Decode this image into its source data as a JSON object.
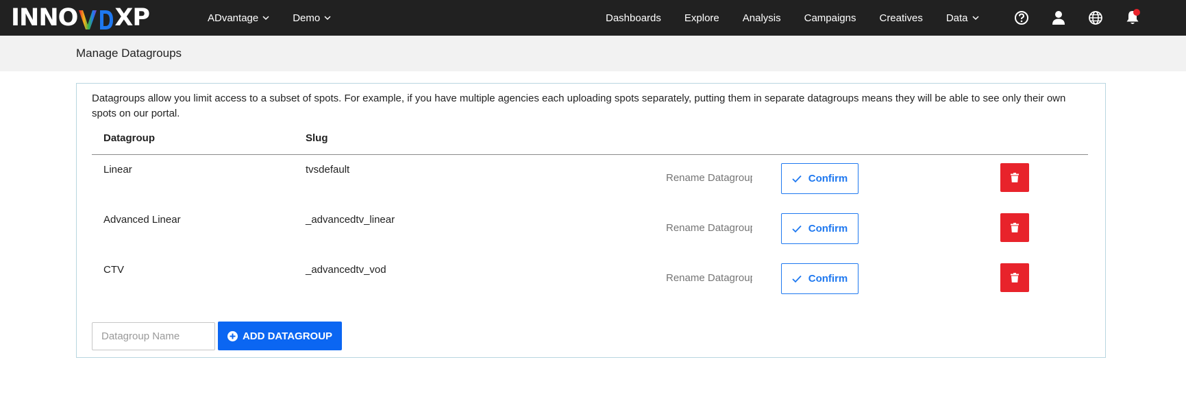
{
  "brand": {
    "logo_prefix": "INNO",
    "logo_suffix": "XP"
  },
  "nav": {
    "left": [
      {
        "label": "ADvantage"
      },
      {
        "label": "Demo"
      }
    ],
    "right": [
      {
        "label": "Dashboards"
      },
      {
        "label": "Explore"
      },
      {
        "label": "Analysis"
      },
      {
        "label": "Campaigns"
      },
      {
        "label": "Creatives"
      },
      {
        "label": "Data"
      }
    ],
    "icons": [
      "help-icon",
      "user-icon",
      "globe-icon",
      "bell-icon"
    ]
  },
  "page": {
    "title": "Manage Datagroups",
    "intro": "Datagroups allow you limit access to a subset of spots. For example, if you have multiple agencies each uploading spots separately, putting them in separate datagroups means they will be able to see only their own spots on our portal."
  },
  "table": {
    "headers": {
      "datagroup": "Datagroup",
      "slug": "Slug"
    },
    "rows": [
      {
        "name": "Linear",
        "slug": "tvsdefault",
        "rename_placeholder": "Rename Datagroup",
        "confirm_label": "Confirm"
      },
      {
        "name": "Advanced Linear",
        "slug": "_advancedtv_linear",
        "rename_placeholder": "Rename Datagroup",
        "confirm_label": "Confirm"
      },
      {
        "name": "CTV",
        "slug": "_advancedtv_vod",
        "rename_placeholder": "Rename Datagroup",
        "confirm_label": "Confirm"
      }
    ]
  },
  "add": {
    "placeholder": "Datagroup Name",
    "button_label": "ADD DATAGROUP"
  },
  "colors": {
    "topbar": "#212121",
    "accent": "#1e78f0",
    "primary_button": "#0b66f2",
    "danger": "#e8232b"
  }
}
